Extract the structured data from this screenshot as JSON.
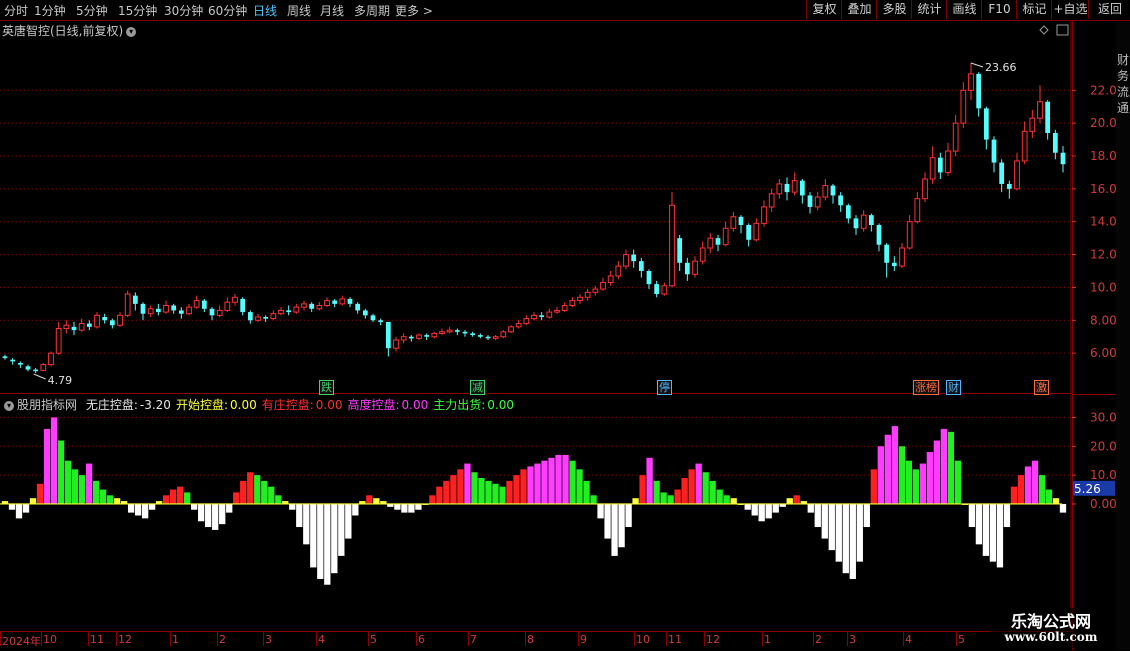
{
  "toolbar": {
    "periods": [
      "分时",
      "1分钟",
      "5分钟",
      "15分钟",
      "30分钟",
      "60分钟",
      "日线",
      "周线",
      "月线",
      "多周期",
      "更多 >"
    ],
    "active_period": "日线",
    "buttons": [
      "复权",
      "叠加",
      "多股",
      "统计",
      "画线",
      "F10",
      "标记",
      "+自选",
      "返回"
    ]
  },
  "main_chart": {
    "title": "英唐智控(日线,前复权)",
    "high_marker": "23.66",
    "low_marker": "4.79",
    "y_ticks": [
      "22.00",
      "20.00",
      "18.00",
      "16.00",
      "14.00",
      "12.00",
      "10.00",
      "8.00",
      "6.00"
    ],
    "event_tags": [
      {
        "text": "跌",
        "color": "#3fd36a"
      },
      {
        "text": "减",
        "color": "#3fd36a"
      },
      {
        "text": "停",
        "color": "#4fb6ff"
      },
      {
        "text": "涨榜",
        "color": "#ff6a3a"
      },
      {
        "text": "财",
        "color": "#4fb6ff"
      },
      {
        "text": "激",
        "color": "#ff6a3a"
      }
    ]
  },
  "indicator": {
    "name": "股朋指标网",
    "items": [
      {
        "label": "无庄控盘:",
        "value": "-3.20",
        "color": "#e6e6e6"
      },
      {
        "label": "开始控盘:",
        "value": "0.00",
        "color": "#ffff3a"
      },
      {
        "label": "有庄控盘:",
        "value": "0.00",
        "color": "#ff3030"
      },
      {
        "label": "高度控盘:",
        "value": "0.00",
        "color": "#ff3cff"
      },
      {
        "label": "主力出货:",
        "value": "0.00",
        "color": "#3cff3c"
      }
    ],
    "y_ticks": [
      "30.00",
      "20.00",
      "10.00",
      "0.00"
    ],
    "current_value": "5.26"
  },
  "date_axis": {
    "labels": [
      "2024年",
      "10",
      "11",
      "12",
      "1",
      "2",
      "3",
      "4",
      "5",
      "6",
      "7",
      "8",
      "9",
      "10",
      "11",
      "12",
      "1",
      "2",
      "3",
      "4",
      "5"
    ]
  },
  "watermark": {
    "title": "乐淘公式网",
    "url": "www.60lt.com"
  },
  "right_strip": {
    "chars": [
      "财",
      "务",
      "流",
      "通"
    ]
  },
  "colors": {
    "up": "#ff3232",
    "down": "#54ffff",
    "grid": "#8a0000",
    "axis_text": "#d23a3a"
  },
  "chart_data": {
    "type": "candlestick_with_histogram",
    "price_series": [
      [
        5.8,
        5.7,
        5.9,
        5.6
      ],
      [
        5.6,
        5.5,
        5.7,
        5.3
      ],
      [
        5.4,
        5.3,
        5.5,
        5.1
      ],
      [
        5.2,
        5.0,
        5.3,
        4.9
      ],
      [
        5.0,
        4.9,
        5.1,
        4.79
      ],
      [
        4.95,
        5.3,
        5.4,
        4.9
      ],
      [
        5.3,
        6.0,
        6.1,
        5.2
      ],
      [
        6.0,
        7.5,
        7.9,
        5.9
      ],
      [
        7.5,
        7.7,
        8.0,
        7.2
      ],
      [
        7.6,
        7.4,
        7.9,
        7.1
      ],
      [
        7.4,
        7.8,
        8.1,
        7.3
      ],
      [
        7.8,
        7.6,
        8.0,
        7.4
      ],
      [
        7.6,
        8.3,
        8.5,
        7.5
      ],
      [
        8.2,
        8.0,
        8.4,
        7.8
      ],
      [
        8.0,
        7.7,
        8.1,
        7.5
      ],
      [
        7.7,
        8.3,
        8.5,
        7.6
      ],
      [
        8.3,
        9.6,
        9.8,
        8.2
      ],
      [
        9.5,
        9.0,
        9.7,
        8.6
      ],
      [
        9.0,
        8.4,
        9.1,
        8.0
      ],
      [
        8.4,
        8.7,
        8.9,
        8.2
      ],
      [
        8.7,
        8.5,
        9.0,
        8.3
      ],
      [
        8.5,
        8.9,
        9.2,
        8.4
      ],
      [
        8.9,
        8.6,
        9.0,
        8.4
      ],
      [
        8.6,
        8.4,
        8.8,
        8.1
      ],
      [
        8.4,
        8.8,
        9.0,
        8.3
      ],
      [
        8.8,
        9.2,
        9.5,
        8.7
      ],
      [
        9.2,
        8.7,
        9.3,
        8.5
      ],
      [
        8.7,
        8.3,
        8.8,
        8.0
      ],
      [
        8.3,
        8.6,
        8.9,
        8.2
      ],
      [
        8.6,
        9.1,
        9.4,
        8.5
      ],
      [
        9.1,
        9.4,
        9.6,
        8.9
      ],
      [
        9.3,
        8.5,
        9.4,
        8.3
      ],
      [
        8.5,
        8.0,
        8.6,
        7.8
      ],
      [
        8.0,
        8.2,
        8.4,
        7.9
      ],
      [
        8.2,
        8.1,
        8.3,
        7.9
      ],
      [
        8.1,
        8.4,
        8.6,
        8.0
      ],
      [
        8.4,
        8.6,
        8.8,
        8.3
      ],
      [
        8.6,
        8.5,
        8.9,
        8.3
      ],
      [
        8.5,
        8.8,
        9.0,
        8.4
      ],
      [
        8.8,
        9.0,
        9.2,
        8.6
      ],
      [
        9.0,
        8.7,
        9.1,
        8.5
      ],
      [
        8.7,
        8.9,
        9.1,
        8.6
      ],
      [
        8.9,
        9.2,
        9.4,
        8.8
      ],
      [
        9.2,
        9.0,
        9.3,
        8.8
      ],
      [
        9.0,
        9.3,
        9.5,
        8.9
      ],
      [
        9.3,
        9.0,
        9.4,
        8.8
      ],
      [
        9.0,
        8.6,
        9.1,
        8.4
      ],
      [
        8.6,
        8.3,
        8.7,
        8.1
      ],
      [
        8.3,
        8.0,
        8.4,
        7.9
      ],
      [
        8.0,
        7.9,
        8.1,
        7.7
      ],
      [
        7.9,
        6.3,
        7.9,
        5.8
      ],
      [
        6.3,
        6.8,
        7.0,
        6.1
      ],
      [
        6.8,
        7.0,
        7.2,
        6.6
      ],
      [
        7.0,
        6.9,
        7.1,
        6.7
      ],
      [
        6.9,
        7.1,
        7.2,
        6.8
      ],
      [
        7.1,
        7.0,
        7.2,
        6.8
      ],
      [
        7.0,
        7.2,
        7.3,
        6.9
      ],
      [
        7.2,
        7.3,
        7.5,
        7.1
      ],
      [
        7.3,
        7.4,
        7.6,
        7.2
      ],
      [
        7.4,
        7.3,
        7.5,
        7.1
      ],
      [
        7.3,
        7.2,
        7.4,
        7.0
      ],
      [
        7.2,
        7.1,
        7.3,
        7.0
      ],
      [
        7.1,
        7.0,
        7.2,
        6.9
      ],
      [
        7.0,
        6.9,
        7.1,
        6.8
      ],
      [
        6.9,
        7.0,
        7.1,
        6.8
      ],
      [
        7.0,
        7.3,
        7.4,
        6.9
      ],
      [
        7.3,
        7.6,
        7.7,
        7.2
      ],
      [
        7.6,
        7.8,
        8.0,
        7.5
      ],
      [
        7.8,
        8.1,
        8.3,
        7.7
      ],
      [
        8.1,
        8.3,
        8.5,
        8.0
      ],
      [
        8.3,
        8.2,
        8.5,
        8.0
      ],
      [
        8.2,
        8.5,
        8.7,
        8.1
      ],
      [
        8.5,
        8.6,
        8.8,
        8.4
      ],
      [
        8.6,
        8.9,
        9.1,
        8.5
      ],
      [
        8.9,
        9.2,
        9.4,
        8.8
      ],
      [
        9.2,
        9.4,
        9.6,
        9.0
      ],
      [
        9.4,
        9.7,
        9.9,
        9.2
      ],
      [
        9.7,
        9.9,
        10.1,
        9.5
      ],
      [
        9.9,
        10.3,
        10.6,
        9.8
      ],
      [
        10.3,
        10.7,
        11.0,
        10.1
      ],
      [
        10.7,
        11.3,
        11.6,
        10.5
      ],
      [
        11.3,
        12.0,
        12.3,
        11.1
      ],
      [
        12.0,
        11.6,
        12.3,
        11.2
      ],
      [
        11.6,
        11.0,
        11.8,
        10.6
      ],
      [
        11.0,
        10.2,
        11.1,
        9.9
      ],
      [
        10.2,
        9.6,
        10.4,
        9.4
      ],
      [
        9.6,
        10.1,
        10.3,
        9.5
      ],
      [
        10.1,
        15.0,
        15.8,
        10.0
      ],
      [
        13.0,
        11.5,
        13.2,
        11.0
      ],
      [
        11.5,
        10.8,
        11.8,
        10.4
      ],
      [
        10.8,
        11.6,
        11.9,
        10.6
      ],
      [
        11.6,
        12.4,
        12.8,
        11.4
      ],
      [
        12.4,
        13.0,
        13.3,
        12.1
      ],
      [
        13.0,
        12.6,
        13.2,
        12.2
      ],
      [
        12.6,
        13.6,
        14.0,
        12.5
      ],
      [
        13.6,
        14.3,
        14.6,
        13.4
      ],
      [
        14.3,
        13.8,
        14.4,
        13.3
      ],
      [
        13.8,
        12.9,
        13.9,
        12.5
      ],
      [
        12.9,
        13.9,
        14.2,
        12.8
      ],
      [
        13.9,
        14.9,
        15.3,
        13.7
      ],
      [
        14.9,
        15.7,
        16.0,
        14.6
      ],
      [
        15.7,
        16.3,
        16.6,
        15.4
      ],
      [
        16.3,
        15.8,
        16.7,
        15.3
      ],
      [
        15.8,
        16.5,
        17.0,
        15.6
      ],
      [
        16.5,
        15.6,
        16.6,
        15.1
      ],
      [
        15.6,
        14.9,
        15.8,
        14.5
      ],
      [
        14.9,
        15.5,
        15.8,
        14.7
      ],
      [
        15.5,
        16.2,
        16.6,
        15.3
      ],
      [
        16.2,
        15.6,
        16.3,
        15.1
      ],
      [
        15.6,
        15.0,
        15.8,
        14.6
      ],
      [
        15.0,
        14.2,
        15.1,
        13.9
      ],
      [
        14.2,
        13.6,
        14.4,
        13.2
      ],
      [
        13.6,
        14.4,
        14.7,
        13.4
      ],
      [
        14.4,
        13.8,
        14.5,
        13.4
      ],
      [
        13.8,
        12.6,
        13.9,
        12.2
      ],
      [
        12.6,
        11.5,
        12.7,
        10.6
      ],
      [
        11.5,
        11.3,
        11.9,
        11.0
      ],
      [
        11.3,
        12.4,
        12.7,
        11.2
      ],
      [
        12.4,
        14.0,
        14.4,
        12.3
      ],
      [
        14.0,
        15.4,
        15.8,
        13.9
      ],
      [
        15.4,
        16.6,
        17.0,
        15.2
      ],
      [
        16.6,
        17.9,
        18.6,
        16.3
      ],
      [
        17.9,
        17.0,
        18.2,
        16.6
      ],
      [
        17.0,
        18.3,
        18.8,
        16.8
      ],
      [
        18.3,
        20.0,
        20.5,
        18.0
      ],
      [
        20.0,
        22.0,
        22.5,
        19.7
      ],
      [
        22.0,
        23.0,
        23.66,
        21.4
      ],
      [
        23.0,
        20.9,
        23.1,
        20.4
      ],
      [
        20.9,
        19.0,
        21.0,
        18.4
      ],
      [
        19.0,
        17.6,
        19.2,
        17.0
      ],
      [
        17.6,
        16.3,
        17.8,
        15.8
      ],
      [
        16.3,
        16.0,
        16.5,
        15.4
      ],
      [
        16.0,
        17.7,
        18.2,
        15.9
      ],
      [
        17.7,
        19.5,
        20.1,
        17.5
      ],
      [
        19.5,
        20.3,
        20.8,
        19.1
      ],
      [
        20.3,
        21.3,
        22.3,
        20.0
      ],
      [
        21.3,
        19.4,
        21.4,
        19.0
      ],
      [
        19.4,
        18.2,
        19.6,
        17.8
      ],
      [
        18.2,
        17.5,
        18.6,
        17.0
      ]
    ],
    "indicator_series": [
      1,
      -2,
      -5,
      -3,
      2,
      7,
      26,
      30,
      22,
      15,
      12,
      10,
      14,
      8,
      5,
      3,
      2,
      1,
      -3,
      -4,
      -5,
      -2,
      1,
      3,
      5,
      6,
      4,
      -2,
      -6,
      -8,
      -9,
      -7,
      -3,
      4,
      8,
      11,
      10,
      8,
      6,
      3,
      1,
      -2,
      -8,
      -14,
      -22,
      -26,
      -28,
      -24,
      -18,
      -12,
      -4,
      1,
      3,
      2,
      1,
      -1,
      -2,
      -3,
      -3,
      -2,
      0,
      3,
      6,
      8,
      10,
      12,
      14,
      11,
      9,
      8,
      7,
      6,
      8,
      10,
      12,
      13,
      14,
      15,
      16,
      17,
      17,
      15,
      12,
      8,
      3,
      -5,
      -12,
      -18,
      -15,
      -8,
      2,
      10,
      16,
      8,
      4,
      3,
      5,
      9,
      12,
      14,
      11,
      8,
      5,
      3,
      2,
      0,
      -2,
      -4,
      -6,
      -5,
      -3,
      -1,
      2,
      3,
      1,
      -3,
      -8,
      -12,
      -16,
      -20,
      -24,
      -26,
      -20,
      -8,
      12,
      20,
      24,
      27,
      20,
      15,
      12,
      14,
      18,
      22,
      26,
      25,
      15,
      0,
      -8,
      -14,
      -18,
      -20,
      -22,
      -8,
      6,
      10,
      13,
      15,
      10,
      5,
      2,
      -3
    ],
    "ylim_price": [
      4.0,
      25.0
    ],
    "ylim_indicator": [
      -43,
      35
    ],
    "grid": true
  }
}
